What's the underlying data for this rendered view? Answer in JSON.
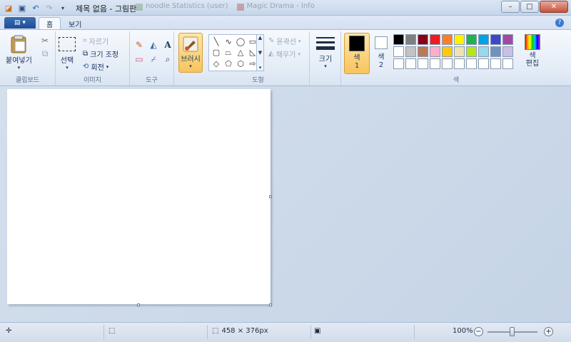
{
  "titlebar": {
    "title": "제목 없음 - 그림판",
    "ghost_tabs": [
      "noodle Statistics (user)",
      "Magic Drama - Info"
    ]
  },
  "window_buttons": {
    "minimize": "–",
    "maximize": "□",
    "close": "✕"
  },
  "tabs": {
    "app_menu": "▤ ▾",
    "home": "홈",
    "view": "보기"
  },
  "clipboard": {
    "paste": "붙여넣기",
    "label": "클립보드"
  },
  "image": {
    "select": "선택",
    "crop": "자르기",
    "resize": "크기 조정",
    "rotate": "회전",
    "label": "이미지"
  },
  "tools": {
    "label": "도구"
  },
  "brushes": {
    "label": "브러시"
  },
  "shapes": {
    "outline": "윤곽선",
    "fill": "채우기",
    "label": "도형"
  },
  "size": {
    "label": "크기"
  },
  "colors": {
    "color1_label": "색\n1",
    "color1_line1": "색",
    "color1_line2": "1",
    "color2_line1": "색",
    "color2_line2": "2",
    "edit_line1": "색",
    "edit_line2": "편집",
    "label": "색",
    "color1_value": "#000000",
    "color2_value": "#ffffff",
    "palette": [
      "#000000",
      "#7f7f7f",
      "#880015",
      "#ed1c24",
      "#ff7f27",
      "#fff200",
      "#22b14c",
      "#00a2e8",
      "#3f48cc",
      "#a349a4",
      "#ffffff",
      "#c3c3c3",
      "#b97a57",
      "#ffaec9",
      "#ffc90e",
      "#efe4b0",
      "#b5e61d",
      "#99d9ea",
      "#7092be",
      "#c8bfe7",
      "#ffffff",
      "#ffffff",
      "#ffffff",
      "#ffffff",
      "#ffffff",
      "#ffffff",
      "#ffffff",
      "#ffffff",
      "#ffffff",
      "#ffffff"
    ]
  },
  "status": {
    "dimensions": "458 × 376px",
    "zoom": "100%"
  }
}
